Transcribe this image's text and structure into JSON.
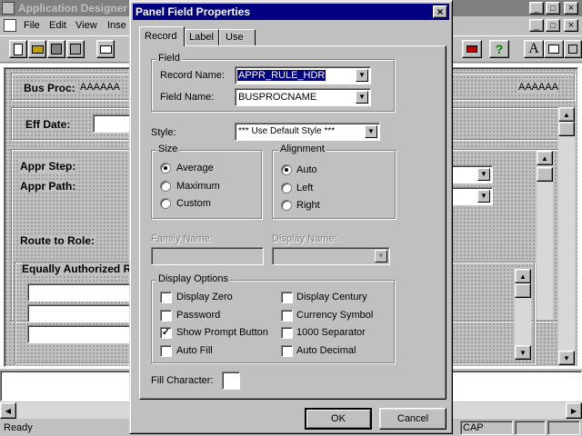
{
  "app": {
    "title": "Application Designer",
    "menu": [
      "File",
      "Edit",
      "View",
      "Inse"
    ],
    "window_controls": {
      "min": "_",
      "max": "□",
      "close": "×"
    },
    "doc_controls": {
      "min": "_",
      "max": "□",
      "close": "×"
    },
    "toolbar_right": {
      "help": "?",
      "text_tool": "A"
    }
  },
  "panel": {
    "bus_proc_label": "Bus Proc:",
    "bus_proc_value": "AAAAAA",
    "eff_date_label": "Eff Date:",
    "appr_step_label": "Appr Step:",
    "appr_path_label": "Appr Path:",
    "route_to_role_label": "Route to Role:",
    "equally_authorized_label": "Equally Authorized R",
    "right_value_fragment": "AAAAAA"
  },
  "status": {
    "ready": "Ready",
    "cap": "CAP"
  },
  "dialog": {
    "title": "Panel Field Properties",
    "close": "×",
    "tabs": [
      "Record",
      "Label",
      "Use"
    ],
    "field_group": "Field",
    "record_name_label": "Record Name:",
    "record_name_value": "APPR_RULE_HDR",
    "field_name_label": "Field Name:",
    "field_name_value": "BUSPROCNAME",
    "style_label": "Style:",
    "style_value": "*** Use Default Style ***",
    "size_group": "Size",
    "size_options": [
      "Average",
      "Maximum",
      "Custom"
    ],
    "size_selected": "Average",
    "alignment_group": "Alignment",
    "alignment_options": [
      "Auto",
      "Left",
      "Right"
    ],
    "alignment_selected": "Auto",
    "family_name_label": "Family Name:",
    "display_name_label": "Display Name:",
    "display_options_group": "Display Options",
    "options_left": [
      {
        "label": "Display Zero",
        "checked": false
      },
      {
        "label": "Password",
        "checked": false
      },
      {
        "label": "Show Prompt Button",
        "checked": true
      },
      {
        "label": "Auto Fill",
        "checked": false
      }
    ],
    "options_right": [
      {
        "label": "Display Century",
        "checked": false
      },
      {
        "label": "Currency Symbol",
        "checked": false
      },
      {
        "label": "1000 Separator",
        "checked": false
      },
      {
        "label": "Auto Decimal",
        "checked": false
      }
    ],
    "fill_character_label": "Fill Character:",
    "ok_label": "OK",
    "cancel_label": "Cancel"
  },
  "colors": {
    "title_active": "#000080",
    "title_inactive": "#808080",
    "selection": "#000080"
  }
}
